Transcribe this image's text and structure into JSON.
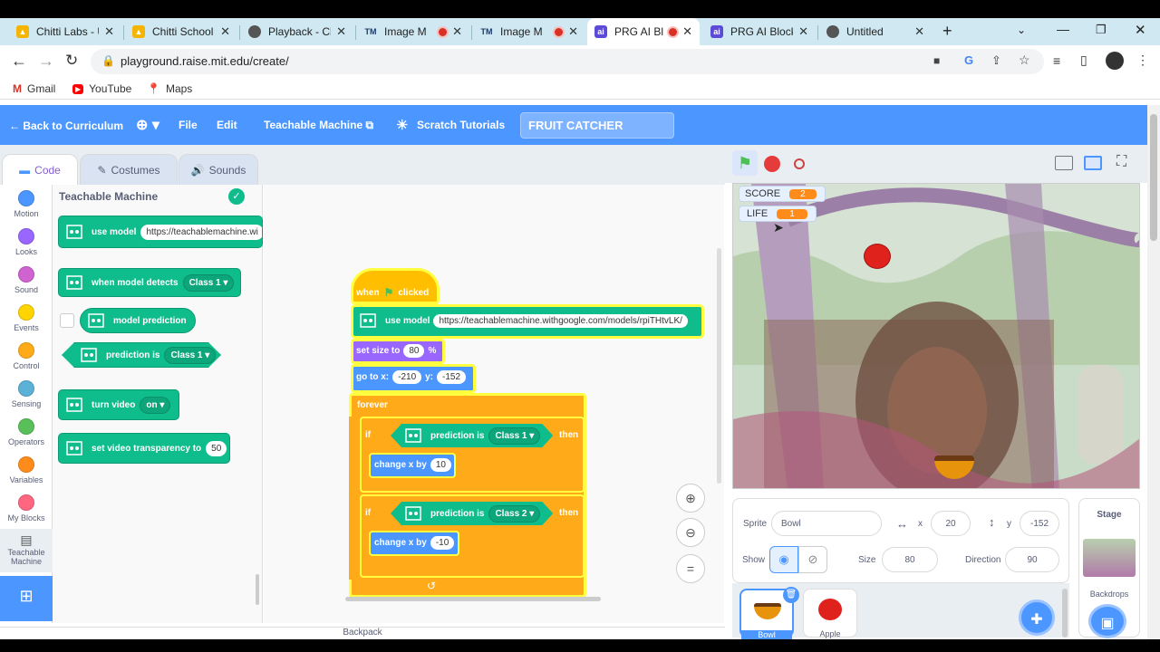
{
  "browser": {
    "tabs": [
      {
        "title": "Chitti Labs - U",
        "icon": "chitti-icon"
      },
      {
        "title": "Chitti School",
        "icon": "chitti-icon"
      },
      {
        "title": "Playback - Ch",
        "icon": "globe-icon"
      },
      {
        "title": "Image M",
        "icon": "tm-icon"
      },
      {
        "title": "Image M",
        "icon": "tm-icon"
      },
      {
        "title": "PRG AI Bl",
        "icon": "ai-icon"
      },
      {
        "title": "PRG AI Blocks",
        "icon": "ai-icon"
      },
      {
        "title": "Untitled",
        "icon": "globe-icon"
      }
    ],
    "url": "playground.raise.mit.edu/create/",
    "bookmarks": [
      "Gmail",
      "YouTube",
      "Maps"
    ]
  },
  "menubar": {
    "back": "Back to Curriculum",
    "file": "File",
    "edit": "Edit",
    "teachable": "Teachable Machine",
    "tutorials": "Scratch Tutorials",
    "project_title": "FRUIT CATCHER"
  },
  "editor_tabs": {
    "code": "Code",
    "costumes": "Costumes",
    "sounds": "Sounds"
  },
  "categories": [
    {
      "label": "Motion",
      "color": "#4c97ff"
    },
    {
      "label": "Looks",
      "color": "#9966ff"
    },
    {
      "label": "Sound",
      "color": "#cf63cf"
    },
    {
      "label": "Events",
      "color": "#ffd500"
    },
    {
      "label": "Control",
      "color": "#ffab19"
    },
    {
      "label": "Sensing",
      "color": "#5cb1d6"
    },
    {
      "label": "Operators",
      "color": "#59c059"
    },
    {
      "label": "Variables",
      "color": "#ff8c1a"
    },
    {
      "label": "My Blocks",
      "color": "#ff6680"
    },
    {
      "label": "Teachable Machine",
      "color": "#0fbd8c"
    }
  ],
  "palette": {
    "heading": "Teachable Machine",
    "use_model": "use model",
    "use_model_url": "https://teachablemachine.wi",
    "when_detects": "when model detects",
    "when_detects_class": "Class 1",
    "model_prediction": "model prediction",
    "prediction_is": "prediction is",
    "prediction_class": "Class 1",
    "turn_video": "turn video",
    "turn_video_val": "on",
    "set_transparency": "set video transparency to",
    "transparency_val": "50"
  },
  "script": {
    "when": "when",
    "clicked": "clicked",
    "use_model": "use model",
    "model_url": "https://teachablemachine.withgoogle.com/models/rpiTHtvLK/",
    "set_size": "set size to",
    "size_val": "80",
    "percent": "%",
    "goto": "go to x:",
    "goto_x": "-210",
    "goto_y_label": "y:",
    "goto_y": "-152",
    "forever": "forever",
    "if1": "if",
    "pred1": "prediction is",
    "pred1_class": "Class 1",
    "then1": "then",
    "change1": "change x by",
    "change1_val": "10",
    "if2": "if",
    "pred2": "prediction is",
    "pred2_class": "Class 2",
    "then2": "then",
    "change2": "change x by",
    "change2_val": "-10"
  },
  "stage": {
    "score_label": "SCORE",
    "score": "2",
    "life_label": "LIFE",
    "life": "1"
  },
  "sprite": {
    "label": "Sprite",
    "name": "Bowl",
    "x_label": "x",
    "x": "20",
    "y_label": "y",
    "y": "-152",
    "show_label": "Show",
    "size_label": "Size",
    "size": "80",
    "direction_label": "Direction",
    "direction": "90",
    "sprites": [
      "Bowl",
      "Apple"
    ]
  },
  "stage_panel": {
    "title": "Stage",
    "backdrops": "Backdrops"
  },
  "backpack": "Backpack"
}
